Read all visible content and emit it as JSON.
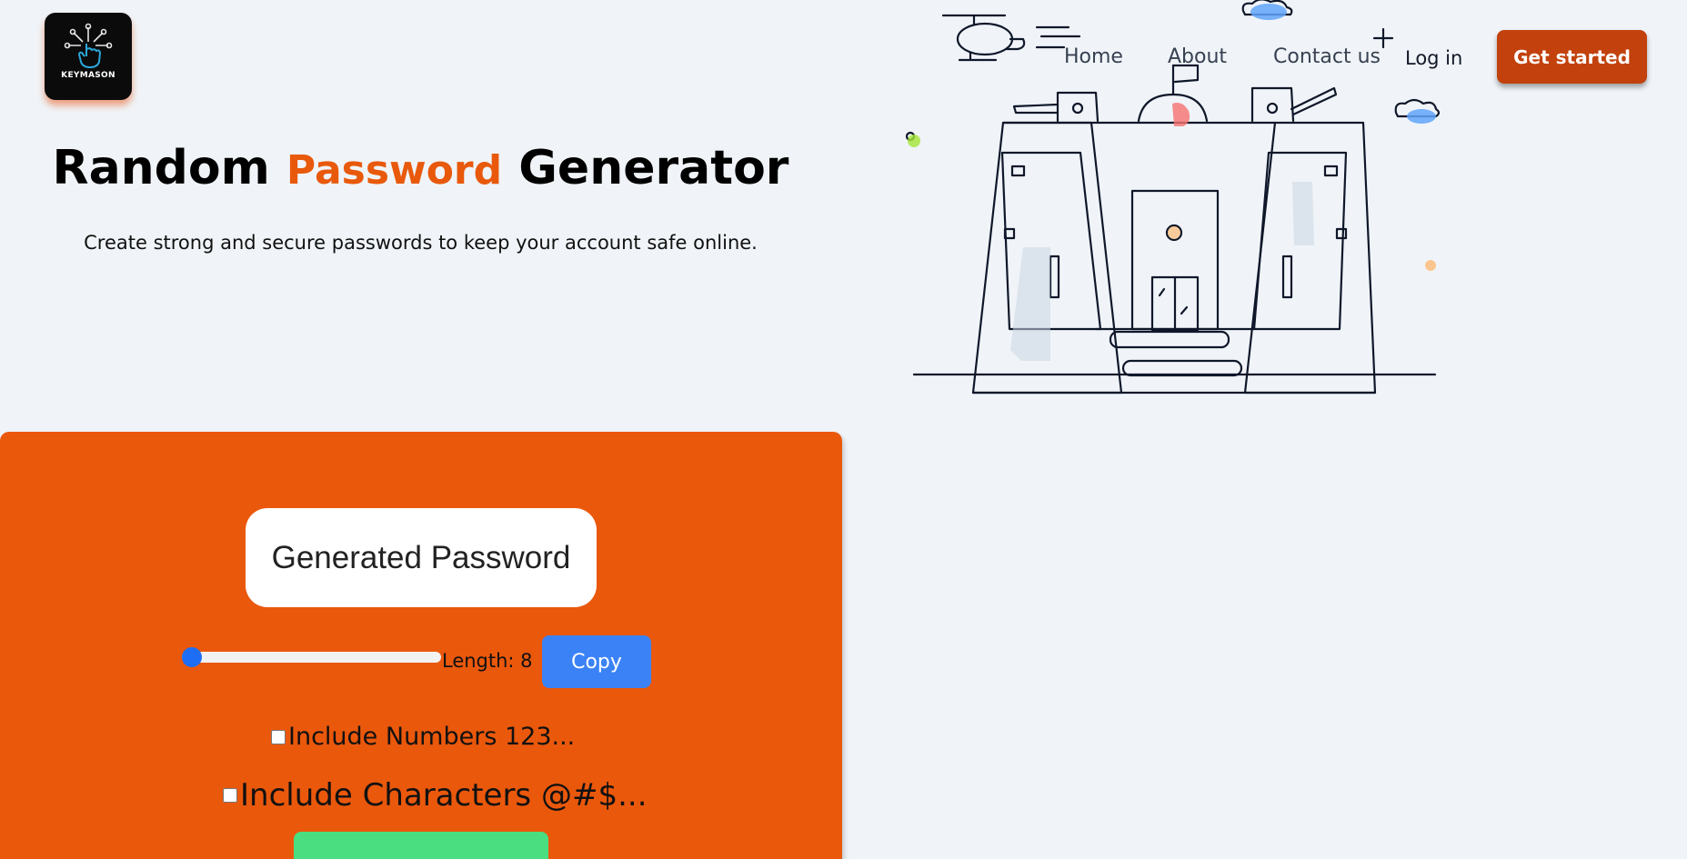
{
  "logo": {
    "text": "KEYMASON"
  },
  "nav": {
    "links": [
      "Home",
      "About",
      "Contact us"
    ],
    "login": "Log in",
    "cta": "Get started"
  },
  "hero": {
    "title_pre": "Random",
    "title_accent": "Password",
    "title_post": "Generator",
    "subtitle": "Create strong and secure passwords to keep your account safe online."
  },
  "generator": {
    "password_placeholder": "Generated Password",
    "length_label": "Length: 8",
    "length_value": 8,
    "copy_label": "Copy",
    "option_numbers": "Include Numbers 123...",
    "option_characters": "Include Characters @#$...",
    "numbers_checked": false,
    "characters_checked": false
  },
  "colors": {
    "accent": "#e8590c",
    "panel": "#ea580c",
    "cta": "#c2410c",
    "copy": "#3b82f6",
    "generate": "#4ade80",
    "background": "#f0f4f8"
  }
}
